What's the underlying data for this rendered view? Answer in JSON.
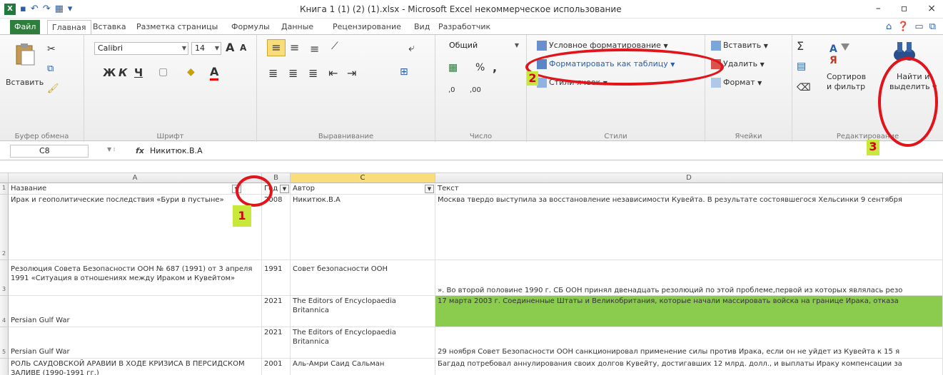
{
  "window": {
    "title": "Книга 1 (1) (2) (1).xlsx - Microsoft Excel некоммерческое использование",
    "minimize": "–",
    "restore": "▫",
    "close": "×"
  },
  "tabs": [
    "Файл",
    "Главная",
    "Вставка",
    "Разметка страницы",
    "Формулы",
    "Данные",
    "Рецензирование",
    "Вид",
    "Разработчик"
  ],
  "ribbon": {
    "clipboard": {
      "paste": "Вставить",
      "label": "Буфер обмена"
    },
    "font": {
      "name": "Calibri",
      "size": "14",
      "bold": "Ж",
      "italic": "К",
      "underline": "Ч",
      "grow": "A",
      "shrink": "A",
      "color_letter": "A",
      "label": "Шрифт"
    },
    "alignment": {
      "label": "Выравнивание"
    },
    "number": {
      "format": "Общий",
      "percent": "%",
      "comma": ",",
      "inc": ",0",
      "dec": ",00",
      "label": "Число"
    },
    "styles": {
      "conditional": "Условное форматирование",
      "as_table": "Форматировать как таблицу",
      "cell_styles": "Стили ячеек",
      "label": "Стили"
    },
    "cells": {
      "insert": "Вставить",
      "delete": "Удалить",
      "format": "Формат",
      "label": "Ячейки"
    },
    "editing": {
      "sum": "Σ",
      "sort": "Сортировка и фильтр",
      "sort_line1": "Сортиров",
      "sort_line2": "и фильтр",
      "find_line1": "Найти и",
      "find_line2": "выделить",
      "label": "Редактирование"
    }
  },
  "formula_bar": {
    "cell": "C8",
    "fx": "fx",
    "value": "Никитюк.В.А"
  },
  "columns": [
    "A",
    "B",
    "C",
    "D"
  ],
  "header_row": {
    "row": "1",
    "a": "Название",
    "b": "Год",
    "c": "Автор",
    "d": "Текст"
  },
  "rows": [
    {
      "row": "2",
      "a": "Ирак и геополитические последствия «Бури в пустыне»",
      "b": "2008",
      "c": "Никитюк.В.А",
      "d": "Москва твердо выступила за восстановление независимости Кувейта. В результате состоявшегося Хельсинки 9 сентября"
    },
    {
      "row": "3",
      "a": "Резолюция Совета Безопасности ООН № 687 (1991) от 3 апреля 1991 «Ситуация в отношениях между Ираком и Кувейтом»",
      "b": "1991",
      "c": "Совет безопасности ООН",
      "d": "». Во второй половине 1990 г. СБ ООН принял двенадцать резолюций по этой проблеме,первой из которых являлась резо"
    },
    {
      "row": "4",
      "a": "Persian Gulf War",
      "b": "2021",
      "c": "The Editors of Encyclopaedia Britannica",
      "d": "17 марта 2003 г. Соединенные Штаты и Великобритания, которые начали массировать войска на границе Ирака, отказа"
    },
    {
      "row": "5",
      "a": "Persian Gulf War",
      "b": "2021",
      "c": "The Editors of Encyclopaedia Britannica",
      "d": "29 ноября Совет Безопасности ООН санкционировал применение силы против Ирака, если он не уйдет из Кувейта к 15 я"
    },
    {
      "row": "",
      "a": "РОЛЬ САУДОВСКОЙ АРАВИИ В ХОДЕ КРИЗИСА В ПЕРСИДСКОМ ЗАЛИВЕ (1990-1991 гг.)",
      "b": "2001",
      "c": "Аль-Амри Саид Сальман",
      "d": "Багдад потребовал аннулирования своих долгов Кувейту, достигавших 12 млрд. долл., и выплаты Ираку компенсации за"
    }
  ],
  "markers": [
    "1",
    "2",
    "3"
  ],
  "colors": {
    "file_tab": "#2f7d3d",
    "highlight_green": "#8bcc4e",
    "annotation_red": "#e1141b",
    "marker_bg": "#c9e83c",
    "selected_col": "#f9dd7a"
  }
}
